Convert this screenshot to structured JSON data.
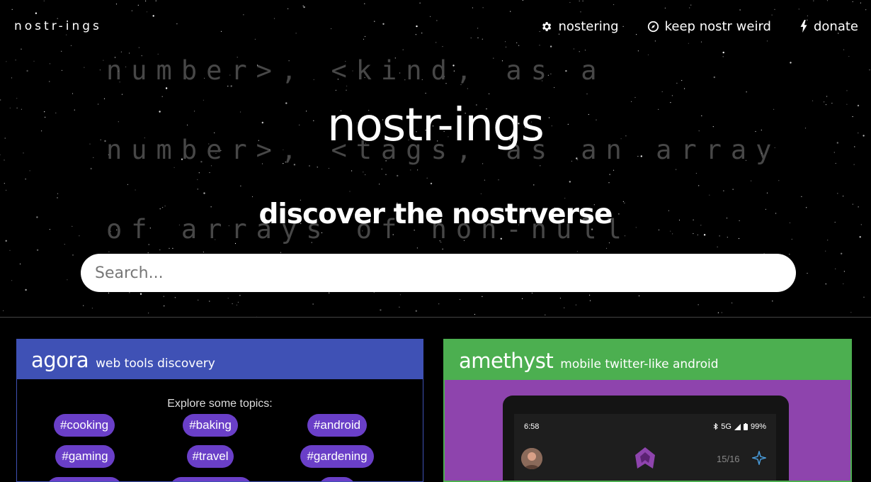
{
  "nav": {
    "brand": "nostr-ings",
    "links": [
      {
        "label": "nostering",
        "icon": "gear-icon"
      },
      {
        "label": "keep nostr weird",
        "icon": "compass-icon"
      },
      {
        "label": "donate",
        "icon": "lightning-icon"
      }
    ]
  },
  "hero": {
    "background_text": [
      "number>, <kind, as a",
      "number>, <tags, as an array",
      "of arrays of non-null"
    ],
    "title": "nostr-ings",
    "subtitle": "discover the nostrverse",
    "search_placeholder": "Search..."
  },
  "cards": [
    {
      "name": "agora",
      "description": "web tools discovery",
      "color": "#3f51b5",
      "explore_label": "Explore some topics:",
      "topics": [
        "#cooking",
        "#baking",
        "#android",
        "#gaming",
        "#travel",
        "#gardening"
      ]
    },
    {
      "name": "amethyst",
      "description": "mobile twitter-like android",
      "color": "#4caf50",
      "preview_bg": "#8e44ad",
      "phone": {
        "time": "6:58",
        "status": "5G",
        "battery": "99%",
        "counter": "15/16"
      }
    }
  ]
}
